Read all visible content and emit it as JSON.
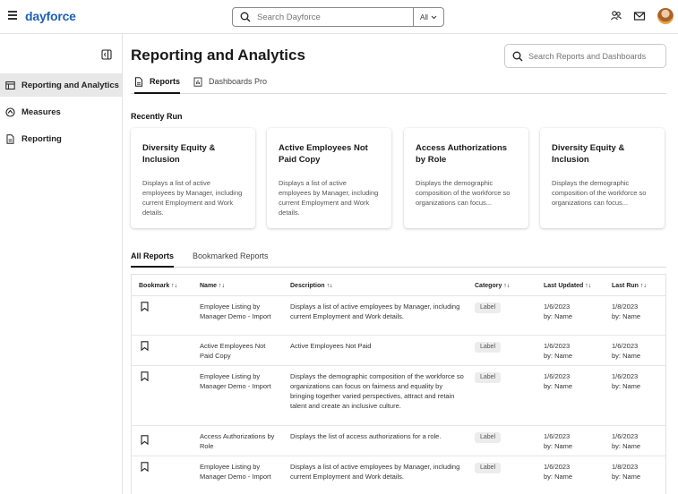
{
  "topbar": {
    "logo": "dayforce",
    "search_placeholder": "Search Dayforce",
    "search_scope": "All"
  },
  "sidebar": {
    "items": [
      {
        "label": "Reporting and Analytics",
        "icon": "report-grid-icon",
        "active": true
      },
      {
        "label": "Measures",
        "icon": "measure-icon",
        "active": false
      },
      {
        "label": "Reporting",
        "icon": "document-icon",
        "active": false
      }
    ]
  },
  "main": {
    "title": "Reporting and Analytics",
    "search_placeholder": "Search Reports and Dashboards",
    "tabs": [
      {
        "label": "Reports",
        "active": true
      },
      {
        "label": "Dashboards Pro",
        "active": false
      }
    ],
    "recently_run_label": "Recently Run",
    "cards": [
      {
        "title": "Diversity Equity & Inclusion",
        "desc": "Displays a list of active employees by Manager, including current Employment and Work details."
      },
      {
        "title": "Active Employees Not Paid Copy",
        "desc": "Displays a list of active employees by Manager, including current Employment and Work details."
      },
      {
        "title": "Access Authorizations by Role",
        "desc": "Displays the demographic composition of the workforce so organizations can focus..."
      },
      {
        "title": "Diversity Equity & Inclusion",
        "desc": "Displays the demographic composition of the workforce so organizations can focus..."
      }
    ],
    "report_tabs": [
      {
        "label": "All Reports",
        "active": true
      },
      {
        "label": "Bookmarked Reports",
        "active": false
      }
    ],
    "table": {
      "headers": [
        "Bookmark ↑↓",
        "Name ↑↓",
        "Description ↑↓",
        "Category ↑↓",
        "Last Updated ↑↓",
        "Last Run ↑↓"
      ],
      "rows": [
        {
          "name": "Employee Listing by Manager Demo - Import",
          "description": "Displays a list of active employees by Manager, including current Employment and Work details.",
          "category": "Label",
          "updated_date": "1/6/2023",
          "updated_by": "by: Name",
          "run_date": "1/8/2023",
          "run_by": "by: Name"
        },
        {
          "name": "Active Employees Not Paid Copy",
          "description": "Active Employees Not Paid",
          "category": "Label",
          "updated_date": "1/6/2023",
          "updated_by": "by: Name",
          "run_date": "1/6/2023",
          "run_by": "by: Name"
        },
        {
          "name": "Employee Listing by Manager Demo - Import",
          "description": "Displays the demographic composition of the workforce so organizations can focus on fairness and equality by bringing together varied perspectives, attract and retain talent and create an inclusive culture.",
          "category": "Label",
          "updated_date": "1/6/2023",
          "updated_by": "by: Name",
          "run_date": "1/6/2023",
          "run_by": "by: Name"
        },
        {
          "name": "Access Authorizations by Role",
          "description": "Displays the list of access authorizations for a role.",
          "category": "Label",
          "updated_date": "1/6/2023",
          "updated_by": "by: Name",
          "run_date": "1/6/2023",
          "run_by": "by: Name"
        },
        {
          "name": "Employee Listing by Manager Demo - Import",
          "description": "Displays a list of active employees by Manager, including current Employment and Work details.",
          "category": "Label",
          "updated_date": "1/6/2023",
          "updated_by": "by: Name",
          "run_date": "1/8/2023",
          "run_by": "by: Name"
        }
      ]
    }
  },
  "colors": {
    "brand": "#1d5fb8",
    "active_nav_bg": "#e8e8e8",
    "badge_bg": "#ececec"
  }
}
